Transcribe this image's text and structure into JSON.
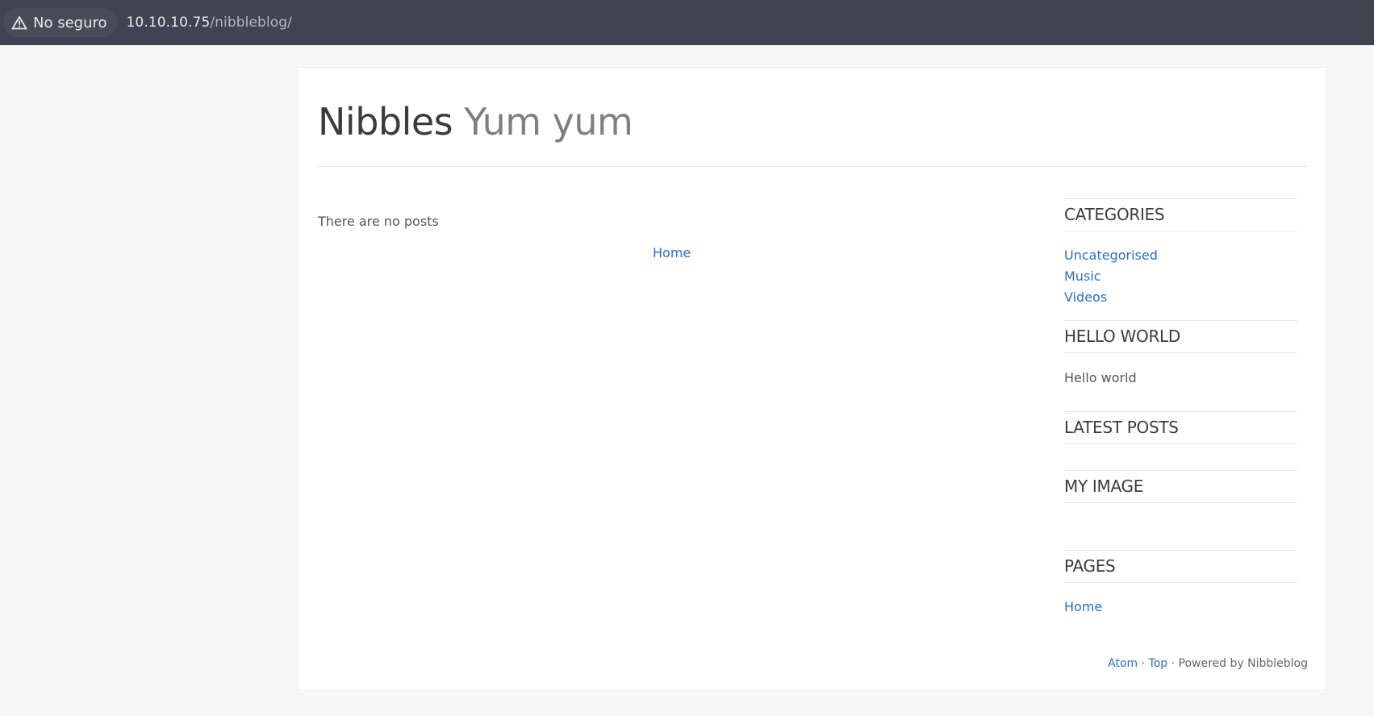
{
  "browser": {
    "security_label": "No seguro",
    "url_host": "10.10.10.75",
    "url_path": "/nibbleblog/"
  },
  "header": {
    "site_name": "Nibbles",
    "slogan": "Yum yum"
  },
  "main": {
    "no_posts": "There are no posts",
    "pager_home": "Home"
  },
  "sidebar": {
    "categories": {
      "title": "CATEGORIES",
      "items": [
        "Uncategorised",
        "Music",
        "Videos"
      ]
    },
    "hello_world": {
      "title": "HELLO WORLD",
      "text": "Hello world"
    },
    "latest_posts": {
      "title": "LATEST POSTS"
    },
    "my_image": {
      "title": "MY IMAGE"
    },
    "pages": {
      "title": "PAGES",
      "items": [
        "Home"
      ]
    }
  },
  "footer": {
    "atom": "Atom",
    "sep1": " · ",
    "top": "Top",
    "sep2": " · ",
    "powered": "Powered by Nibbleblog"
  },
  "colors": {
    "link": "#2a6fc4",
    "browser_bar": "#3f4451",
    "page_bg": "#f7f7f7"
  }
}
